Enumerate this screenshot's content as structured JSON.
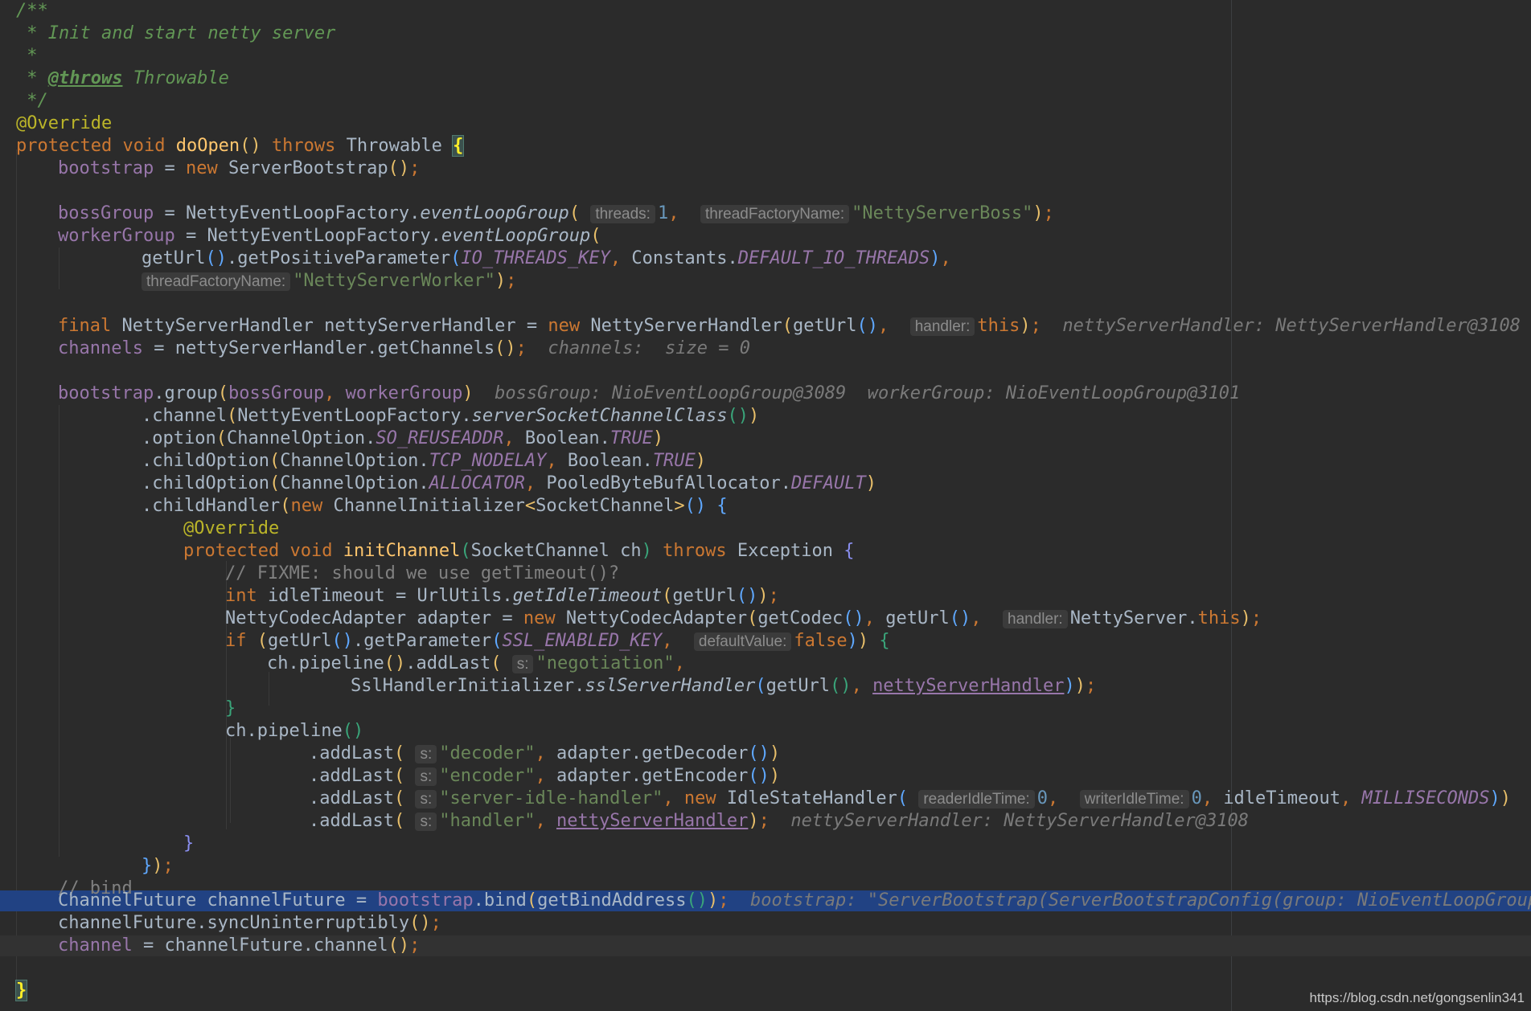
{
  "javadoc": {
    "open": "/**",
    "summary": " * Init and start netty server",
    "blank": " *",
    "star": " * ",
    "throws_tag": "@throws",
    "throws_type": " Throwable",
    "close": " */"
  },
  "annotation": "@Override",
  "header": {
    "protected": "protected",
    "void": "void",
    "name": "doOpen",
    "throws": "throws",
    "type": "Throwable"
  },
  "code": {
    "bootstrap": "bootstrap",
    "new": "new",
    "server_bootstrap": "ServerBootstrap",
    "boss_group": "bossGroup",
    "netty_factory": "NettyEventLoopFactory",
    "event_loop_group": "eventLoopGroup",
    "worker_group": "workerGroup",
    "get_url": "getUrl",
    "get_positive_parameter": "getPositiveParameter",
    "io_threads_key": "IO_THREADS_KEY",
    "constants": "Constants",
    "default_io_threads": "DEFAULT_IO_THREADS",
    "final": "final",
    "netty_server_handler_type": "NettyServerHandler",
    "netty_server_handler_var": "nettyServerHandler",
    "this": "this",
    "channels": "channels",
    "get_channels": "getChannels",
    "group": "group",
    "channel": "channel",
    "server_socket_channel_class": "serverSocketChannelClass",
    "option": "option",
    "channel_option": "ChannelOption",
    "so_reuseaddr": "SO_REUSEADDR",
    "boolean": "Boolean",
    "true": "TRUE",
    "child_option": "childOption",
    "tcp_nodelay": "TCP_NODELAY",
    "allocator": "ALLOCATOR",
    "pooled_allocator": "PooledByteBufAllocator",
    "default": "DEFAULT",
    "child_handler": "childHandler",
    "channel_initializer": "ChannelInitializer",
    "socket_channel": "SocketChannel",
    "protected": "protected",
    "void": "void",
    "init_channel": "initChannel",
    "ch": "ch",
    "throws": "throws",
    "exception": "Exception",
    "fixme_comment": "// FIXME: should we use getTimeout()?",
    "int": "int",
    "idle_timeout": "idleTimeout",
    "url_utils": "UrlUtils",
    "get_idle_timeout": "getIdleTimeout",
    "netty_codec_adapter": "NettyCodecAdapter",
    "adapter": "adapter",
    "get_codec": "getCodec",
    "netty_server": "NettyServer",
    "if": "if",
    "get_parameter": "getParameter",
    "ssl_enabled_key": "SSL_ENABLED_KEY",
    "false": "false",
    "pipeline": "pipeline",
    "add_last": "addLast",
    "negotiation": "\"negotiation\"",
    "ssl_handler_initializer": "SslHandlerInitializer",
    "ssl_server_handler": "sslServerHandler",
    "decoder": "\"decoder\"",
    "get_decoder": "getDecoder",
    "encoder": "\"encoder\"",
    "get_encoder": "getEncoder",
    "server_idle_handler": "\"server-idle-handler\"",
    "idle_state_handler": "IdleStateHandler",
    "milliseconds": "MILLISECONDS",
    "handler_str": "\"handler\"",
    "bind_comment": "// bind",
    "channel_future_type": "ChannelFuture",
    "channel_future_var": "channelFuture",
    "bind": "bind",
    "get_bind_address": "getBindAddress",
    "sync_uninterruptibly": "syncUninterruptibly",
    "channel_field": "channel"
  },
  "literals": {
    "one": "1",
    "zero": "0",
    "boss_name": "\"NettyServerBoss\"",
    "worker_name": "\"NettyServerWorker\""
  },
  "hints": {
    "threads": "threads:",
    "thread_factory_name": "threadFactoryName:",
    "handler": "handler:",
    "default_value": "defaultValue:",
    "s": "s:",
    "reader_idle_time": "readerIdleTime:",
    "writer_idle_time": "writerIdleTime:"
  },
  "debug": {
    "netty_server_handler": "nettyServerHandler: NettyServerHandler@3108",
    "channels_size": "channels:  size = 0",
    "boss_group": "bossGroup: NioEventLoopGroup@3089",
    "worker_group": "workerGroup: NioEventLoopGroup@3101",
    "bootstrap": "bootstrap: \"ServerBootstrap(ServerBootstrapConfig(group: NioEventLoopGroup,"
  },
  "watermark": "https://blog.csdn.net/gongsenlin341"
}
